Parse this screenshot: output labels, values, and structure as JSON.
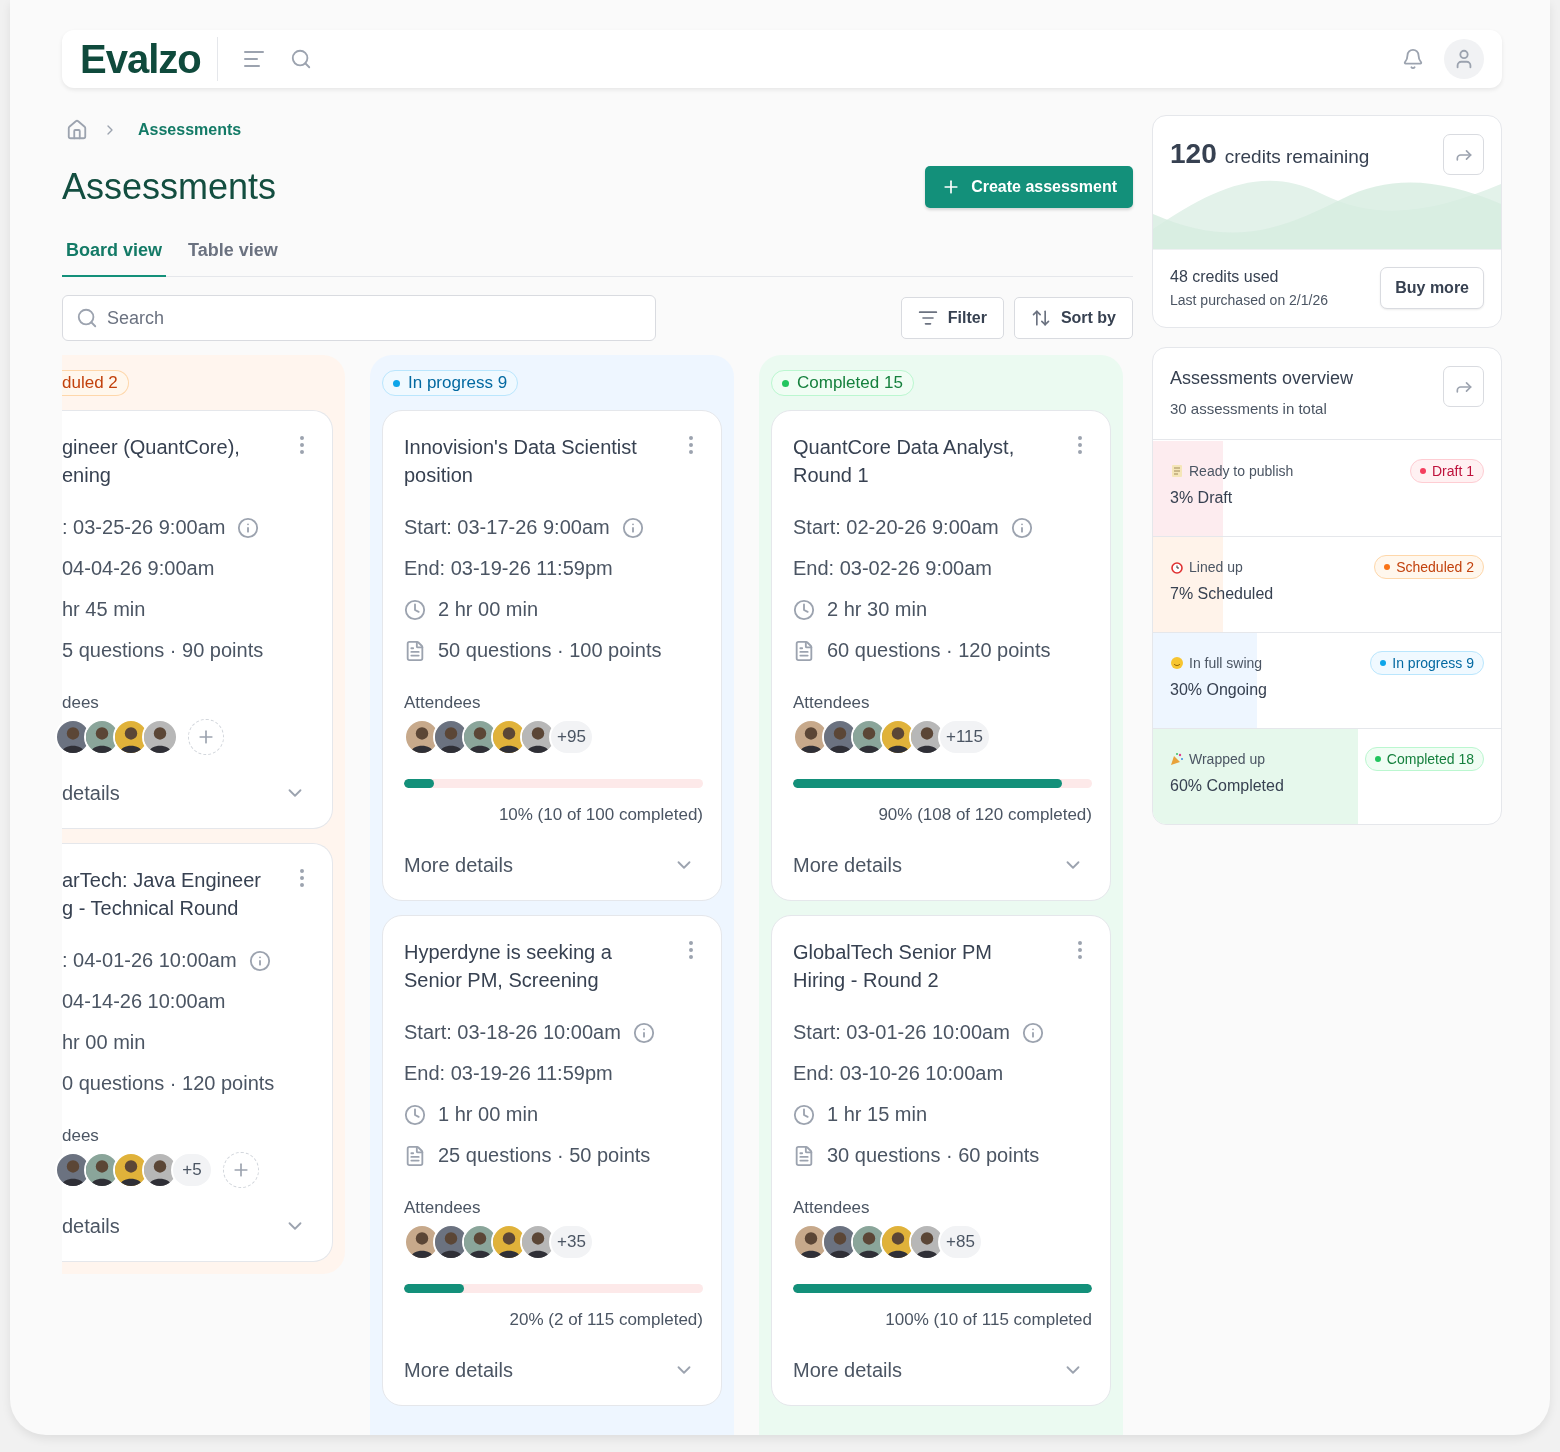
{
  "header": {
    "logo": "Evalzo"
  },
  "breadcrumb": {
    "current": "Assessments"
  },
  "page_title": "Assessments",
  "create_button": "Create assessment",
  "tabs": [
    {
      "label": "Board view",
      "selected": true
    },
    {
      "label": "Table view",
      "selected": false
    }
  ],
  "search": {
    "placeholder": "Search"
  },
  "toolbar": {
    "filter": "Filter",
    "sort": "Sort by"
  },
  "columns": [
    {
      "kind": "scheduled",
      "badge": "duled 2",
      "clipped": true,
      "cards": [
        {
          "title_lines": [
            "gineer (QuantCore),",
            "ening"
          ],
          "start": ": 03-25-26 9:00am",
          "end": "04-04-26 9:00am",
          "duration": "hr 45 min",
          "questions": "5 questions · 90 points",
          "attendees_label": "dees",
          "avatars": [
            {
              "kind": "picture"
            },
            {
              "kind": "picture"
            },
            {
              "kind": "picture"
            },
            {
              "kind": "picture"
            }
          ],
          "can_add": true,
          "more": "details"
        },
        {
          "title_lines": [
            "arTech: Java Engineer",
            "g - Technical Round"
          ],
          "start": ": 04-01-26 10:00am",
          "end": "04-14-26 10:00am",
          "duration": "hr 00 min",
          "questions": "0 questions · 120 points",
          "attendees_label": "dees",
          "avatars": [
            {
              "kind": "picture"
            },
            {
              "kind": "picture"
            },
            {
              "kind": "picture"
            },
            {
              "kind": "picture"
            }
          ],
          "extra": "+5",
          "can_add": true,
          "more": "details"
        }
      ]
    },
    {
      "kind": "in_progress",
      "badge": "In progress 9",
      "clipped": false,
      "cards": [
        {
          "title_lines": [
            "Innovision's Data Scientist",
            "position"
          ],
          "start": "Start: 03-17-26 9:00am",
          "end": "End: 03-19-26 11:59pm",
          "duration": "2 hr 00 min",
          "questions": "50 questions · 100 points",
          "attendees_label": "Attendees",
          "avatars": [
            {
              "kind": "picture"
            },
            {
              "kind": "picture"
            },
            {
              "kind": "picture"
            },
            {
              "kind": "picture"
            },
            {
              "kind": "picture"
            }
          ],
          "extra": "+95",
          "can_add": false,
          "progress": {
            "level": 0.1,
            "text": "10% (10 of 100 completed)"
          },
          "more": "More details"
        },
        {
          "title_lines": [
            "Hyperdyne is seeking a",
            "Senior PM, Screening"
          ],
          "start": "Start: 03-18-26 10:00am",
          "end": "End: 03-19-26 11:59pm",
          "duration": "1 hr 00 min",
          "questions": "25 questions · 50 points",
          "attendees_label": "Attendees",
          "avatars": [
            {
              "kind": "picture"
            },
            {
              "kind": "picture"
            },
            {
              "kind": "picture"
            },
            {
              "kind": "picture"
            },
            {
              "kind": "picture"
            }
          ],
          "extra": "+35",
          "can_add": false,
          "progress": {
            "level": 0.2,
            "text": "20% (2 of 115 completed)"
          },
          "more": "More details"
        }
      ]
    },
    {
      "kind": "completed",
      "badge": "Completed 15",
      "clipped": false,
      "cards": [
        {
          "title_lines": [
            "QuantCore Data Analyst,",
            "Round 1"
          ],
          "start": "Start: 02-20-26 9:00am",
          "end": "End: 03-02-26 9:00am",
          "duration": "2 hr 30 min",
          "questions": "60 questions · 120 points",
          "attendees_label": "Attendees",
          "avatars": [
            {
              "kind": "picture"
            },
            {
              "kind": "picture"
            },
            {
              "kind": "picture"
            },
            {
              "kind": "picture"
            },
            {
              "kind": "picture"
            }
          ],
          "extra": "+115",
          "can_add": false,
          "progress": {
            "level": 0.9,
            "text": "90% (108 of 120 completed)"
          },
          "more": "More details"
        },
        {
          "title_lines": [
            "GlobalTech Senior PM",
            "Hiring - Round 2"
          ],
          "start": "Start: 03-01-26 10:00am",
          "end": "End: 03-10-26 10:00am",
          "duration": "1 hr 15 min",
          "questions": "30 questions · 60 points",
          "attendees_label": "Attendees",
          "avatars": [
            {
              "kind": "picture"
            },
            {
              "kind": "picture"
            },
            {
              "kind": "picture"
            },
            {
              "kind": "picture"
            },
            {
              "kind": "picture"
            }
          ],
          "extra": "+85",
          "can_add": false,
          "progress": {
            "level": 1.0,
            "text": "100% (10 of 115 completed"
          },
          "more": "More details"
        }
      ]
    }
  ],
  "credits": {
    "amount": "120",
    "label": "credits remaining",
    "used": "48 credits used",
    "last_purchase": "Last purchased on 2/1/26",
    "button": "Buy more"
  },
  "overview": {
    "title": "Assessments overview",
    "subtitle": "30 assessments in total",
    "rows": [
      {
        "kind": "draft",
        "label": "Ready to publish",
        "percent": "3% Draft",
        "badge": "Draft 1",
        "level": 0.2
      },
      {
        "kind": "scheduled",
        "label": "Lined up",
        "percent": "7% Scheduled",
        "badge": "Scheduled 2",
        "level": 0.2
      },
      {
        "kind": "in_progress",
        "label": "In full swing",
        "percent": "30% Ongoing",
        "badge": "In progress 9",
        "level": 0.3
      },
      {
        "kind": "completed",
        "label": "Wrapped up",
        "percent": "60% Completed",
        "badge": "Completed 18",
        "level": 0.59
      }
    ]
  }
}
